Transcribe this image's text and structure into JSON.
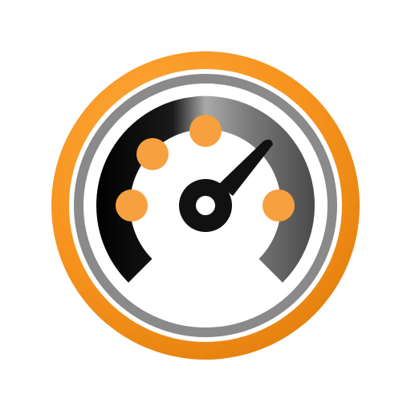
{
  "icon": {
    "name": "speedometer-icon",
    "colors": {
      "outer_ring": "#f7931e",
      "outer_ring_dark": "#e07d0a",
      "gray_ring": "#8a8a8a",
      "gauge_black": "#111111",
      "gauge_dark_gray": "#4f4f4f",
      "gauge_light_gray": "#a8a8a8",
      "face": "#ffffff",
      "dots": "#f7a040",
      "needle": "#111111"
    }
  }
}
